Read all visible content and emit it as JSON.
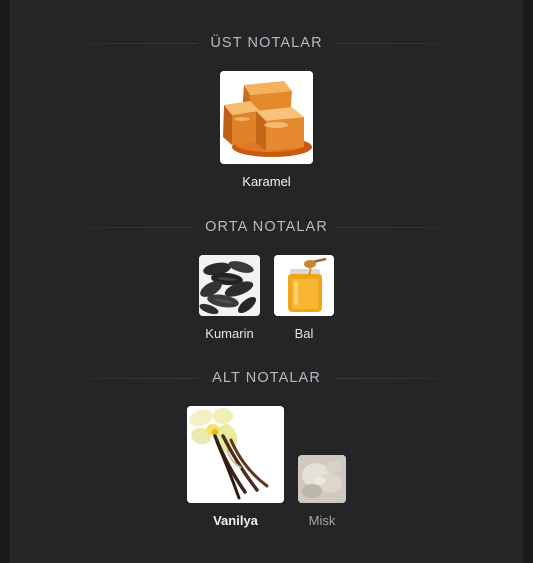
{
  "sections": [
    {
      "title": "ÜST NOTALAR",
      "notes": [
        {
          "label": "Karamel",
          "icon": "caramel-icon"
        }
      ]
    },
    {
      "title": "ORTA NOTALAR",
      "notes": [
        {
          "label": "Kumarin",
          "icon": "tonka-beans-icon"
        },
        {
          "label": "Bal",
          "icon": "honey-jar-icon"
        }
      ]
    },
    {
      "title": "ALT NOTALAR",
      "notes": [
        {
          "label": "Vanilya",
          "icon": "vanilla-icon"
        },
        {
          "label": "Misk",
          "icon": "musk-icon"
        }
      ]
    }
  ],
  "colors": {
    "background": "#1a1a1d",
    "panel": "#252528",
    "section_title": "#b9b9bd",
    "label": "#e4e4e6"
  }
}
